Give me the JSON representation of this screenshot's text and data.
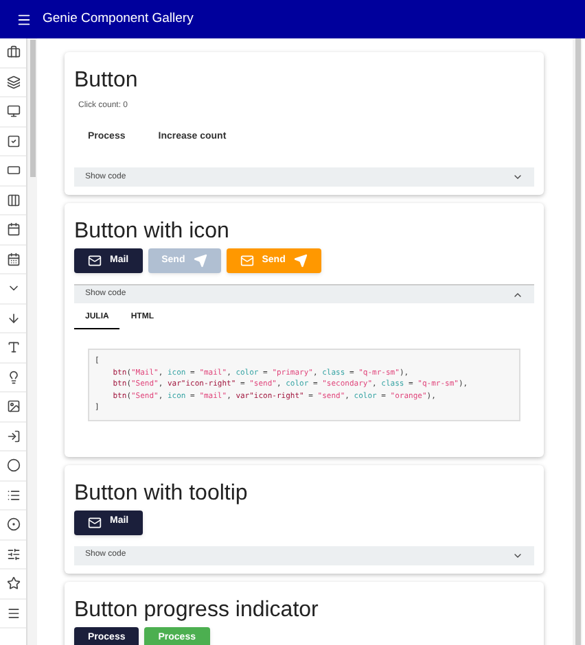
{
  "app_bar": {
    "title": "Genie Component Gallery"
  },
  "sections": [
    {
      "title": "Button",
      "caption": "Click count: 0",
      "buttons": [
        {
          "label": "Process",
          "kind": "flat",
          "disabled": false,
          "icon_left": false,
          "icon_right": false
        },
        {
          "label": "Increase count",
          "kind": "flat",
          "disabled": false,
          "icon_left": false,
          "icon_right": false
        }
      ],
      "code_panel": {
        "label": "Show code",
        "expanded": false
      }
    },
    {
      "title": "Button with icon",
      "buttons": [
        {
          "label": "Mail",
          "kind": "primary",
          "disabled": false,
          "icon_left": true,
          "icon_right": false
        },
        {
          "label": "Send",
          "kind": "secondary",
          "disabled": true,
          "icon_left": false,
          "icon_right": true
        },
        {
          "label": "Send",
          "kind": "orange",
          "disabled": false,
          "icon_left": true,
          "icon_right": true
        }
      ],
      "code_panel": {
        "label": "Show code",
        "expanded": true,
        "tabs": [
          {
            "label": "JULIA",
            "selected": true
          },
          {
            "label": "HTML",
            "selected": false
          }
        ],
        "code_lines": [
          [
            {
              "kind": "plain",
              "text": "["
            }
          ],
          [
            {
              "kind": "fn",
              "text": "    btn"
            },
            {
              "kind": "plain",
              "text": "("
            },
            {
              "kind": "str",
              "text": "\"Mail\""
            },
            {
              "kind": "plain",
              "text": ", "
            },
            {
              "kind": "attr",
              "text": "icon"
            },
            {
              "kind": "plain",
              "text": " = "
            },
            {
              "kind": "str",
              "text": "\"mail\""
            },
            {
              "kind": "plain",
              "text": ", "
            },
            {
              "kind": "attr",
              "text": "color"
            },
            {
              "kind": "plain",
              "text": " = "
            },
            {
              "kind": "str",
              "text": "\"primary\""
            },
            {
              "kind": "plain",
              "text": ", "
            },
            {
              "kind": "attr",
              "text": "class"
            },
            {
              "kind": "plain",
              "text": " = "
            },
            {
              "kind": "str",
              "text": "\"q-mr-sm\""
            },
            {
              "kind": "plain",
              "text": "),"
            }
          ],
          [
            {
              "kind": "fn",
              "text": "    btn"
            },
            {
              "kind": "plain",
              "text": "("
            },
            {
              "kind": "str",
              "text": "\"Send\""
            },
            {
              "kind": "plain",
              "text": ", "
            },
            {
              "kind": "fn",
              "text": "var\"icon-right\""
            },
            {
              "kind": "plain",
              "text": " = "
            },
            {
              "kind": "str",
              "text": "\"send\""
            },
            {
              "kind": "plain",
              "text": ", "
            },
            {
              "kind": "attr",
              "text": "color"
            },
            {
              "kind": "plain",
              "text": " = "
            },
            {
              "kind": "str",
              "text": "\"secondary\""
            },
            {
              "kind": "plain",
              "text": ", "
            },
            {
              "kind": "attr",
              "text": "class"
            },
            {
              "kind": "plain",
              "text": " = "
            },
            {
              "kind": "str",
              "text": "\"q-mr-sm\""
            },
            {
              "kind": "plain",
              "text": "),"
            }
          ],
          [
            {
              "kind": "fn",
              "text": "    btn"
            },
            {
              "kind": "plain",
              "text": "("
            },
            {
              "kind": "str",
              "text": "\"Send\""
            },
            {
              "kind": "plain",
              "text": ", "
            },
            {
              "kind": "attr",
              "text": "icon"
            },
            {
              "kind": "plain",
              "text": " = "
            },
            {
              "kind": "str",
              "text": "\"mail\""
            },
            {
              "kind": "plain",
              "text": ", "
            },
            {
              "kind": "fn",
              "text": "var\"icon-right\""
            },
            {
              "kind": "plain",
              "text": " = "
            },
            {
              "kind": "str",
              "text": "\"send\""
            },
            {
              "kind": "plain",
              "text": ", "
            },
            {
              "kind": "attr",
              "text": "color"
            },
            {
              "kind": "plain",
              "text": " = "
            },
            {
              "kind": "str",
              "text": "\"orange\""
            },
            {
              "kind": "plain",
              "text": "),"
            }
          ],
          [
            {
              "kind": "plain",
              "text": "]"
            }
          ]
        ]
      }
    },
    {
      "title": "Button with tooltip",
      "buttons": [
        {
          "label": "Mail",
          "kind": "primary",
          "disabled": false,
          "icon_left": true,
          "icon_right": false
        }
      ],
      "code_panel": {
        "label": "Show code",
        "expanded": false
      }
    },
    {
      "title": "Button progress indicator",
      "buttons": [
        {
          "label": "Process",
          "kind": "primary",
          "disabled": false,
          "icon_left": false,
          "icon_right": false
        },
        {
          "label": "Process",
          "kind": "green",
          "disabled": false,
          "icon_left": false,
          "icon_right": false
        }
      ]
    }
  ]
}
